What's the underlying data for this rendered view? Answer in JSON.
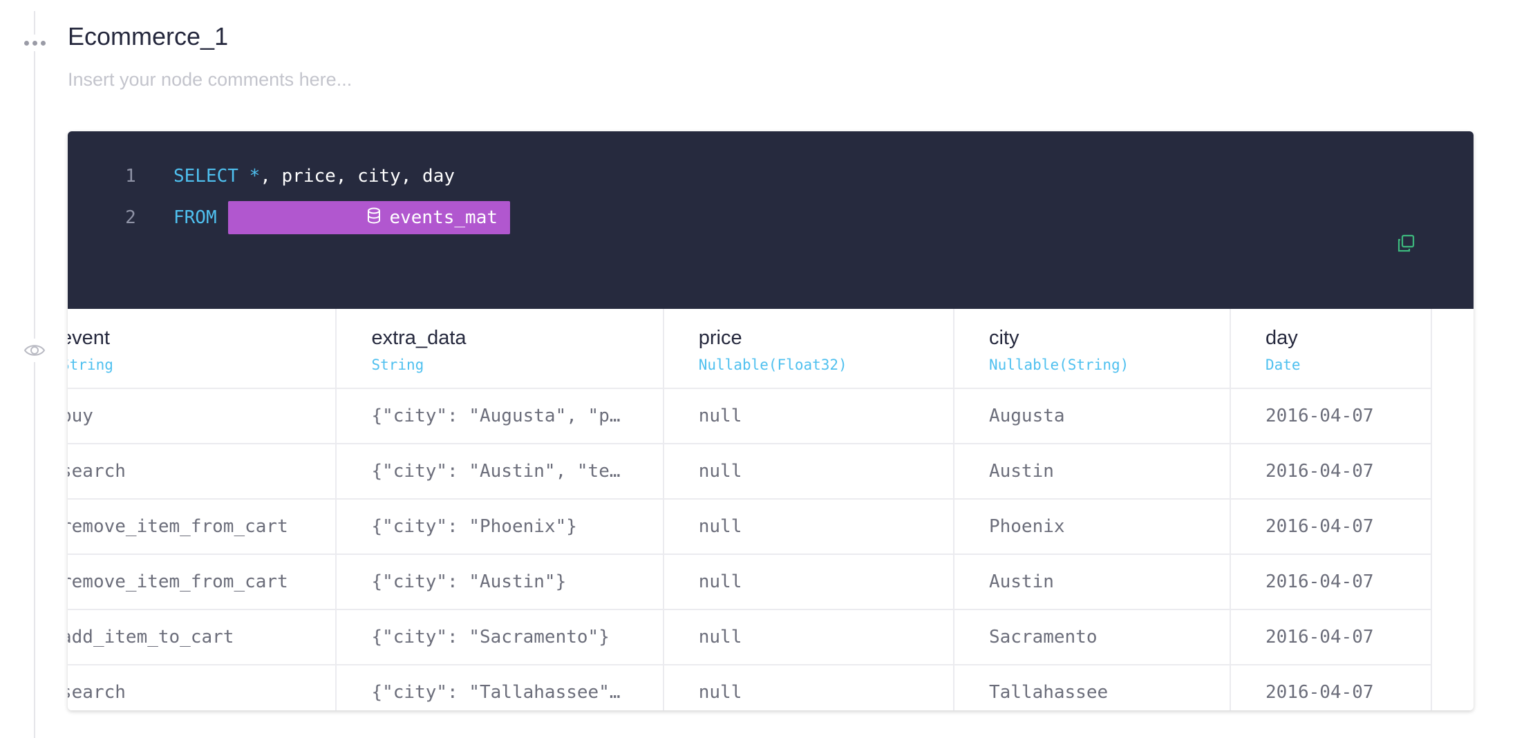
{
  "node": {
    "title": "Ecommerce_1",
    "comments_placeholder": "Insert your node comments here..."
  },
  "editor": {
    "lines": [
      {
        "number": "1",
        "tokens": [
          {
            "text": "SELECT",
            "kind": "kw"
          },
          {
            "text": " ",
            "kind": "plain"
          },
          {
            "text": "*",
            "kind": "kw"
          },
          {
            "text": ", price, city, day",
            "kind": "plain"
          }
        ]
      },
      {
        "number": "2",
        "keyword": "FROM",
        "table_name": "events_mat"
      }
    ]
  },
  "icons": {
    "menu": "more-horizontal-icon",
    "visibility": "eye-icon",
    "table": "database-icon",
    "copy": "copy-icon"
  },
  "colors": {
    "editor_bg": "#262a3e",
    "keyword": "#4fc0ef",
    "table_pill": "#b157cf",
    "copy_icon": "#3dba7e",
    "type_label": "#4fc0ef"
  },
  "results": {
    "columns": [
      {
        "name": "event",
        "type": "String"
      },
      {
        "name": "extra_data",
        "type": "String"
      },
      {
        "name": "price",
        "type": "Nullable(Float32)"
      },
      {
        "name": "city",
        "type": "Nullable(String)"
      },
      {
        "name": "day",
        "type": "Date"
      }
    ],
    "rows": [
      [
        "buy",
        "{\"city\": \"Augusta\", \"p…",
        "null",
        "Augusta",
        "2016-04-07"
      ],
      [
        "search",
        "{\"city\": \"Austin\", \"te…",
        "null",
        "Austin",
        "2016-04-07"
      ],
      [
        "remove_item_from_cart",
        "{\"city\": \"Phoenix\"}",
        "null",
        "Phoenix",
        "2016-04-07"
      ],
      [
        "remove_item_from_cart",
        "{\"city\": \"Austin\"}",
        "null",
        "Austin",
        "2016-04-07"
      ],
      [
        "add_item_to_cart",
        "{\"city\": \"Sacramento\"}",
        "null",
        "Sacramento",
        "2016-04-07"
      ],
      [
        "search",
        "{\"city\": \"Tallahassee\"…",
        "null",
        "Tallahassee",
        "2016-04-07"
      ]
    ]
  }
}
